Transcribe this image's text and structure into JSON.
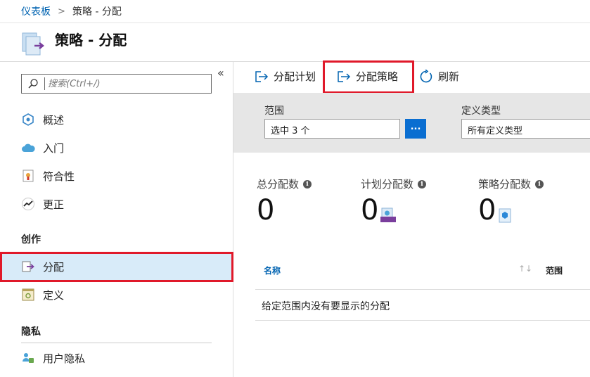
{
  "breadcrumb": {
    "root": "仪表板",
    "separator": ">",
    "current": "策略 - 分配"
  },
  "page": {
    "title": "策略 - 分配"
  },
  "sidebar": {
    "search_placeholder": "搜索(Ctrl+/)",
    "collapse": "«",
    "items": [
      {
        "label": "概述",
        "icon": "overview-icon"
      },
      {
        "label": "入门",
        "icon": "cloud-icon"
      },
      {
        "label": "符合性",
        "icon": "compliance-icon"
      },
      {
        "label": "更正",
        "icon": "remediation-icon"
      }
    ],
    "section_authoring": "创作",
    "authoring_items": [
      {
        "label": "分配",
        "icon": "assignment-icon",
        "active": true
      },
      {
        "label": "定义",
        "icon": "definition-icon"
      }
    ],
    "section_privacy": "隐私",
    "privacy_items": [
      {
        "label": "用户隐私",
        "icon": "user-privacy-icon"
      }
    ]
  },
  "toolbar": {
    "assign_initiative": "分配计划",
    "assign_policy": "分配策略",
    "refresh": "刷新"
  },
  "filters": {
    "scope_label": "范围",
    "scope_value": "选中 3 个",
    "scope_button": "...",
    "definition_type_label": "定义类型",
    "definition_type_value": "所有定义类型"
  },
  "stats": [
    {
      "label": "总分配数",
      "value": "0"
    },
    {
      "label": "计划分配数",
      "value": "0"
    },
    {
      "label": "策略分配数",
      "value": "0"
    }
  ],
  "table": {
    "columns": [
      "名称",
      "范围"
    ],
    "sort_icon": "↑↓",
    "empty_message": "给定范围内没有要显示的分配"
  },
  "colors": {
    "accent": "#0063b1",
    "highlight": "#e0192a",
    "active_bg": "#d8ebf9"
  }
}
